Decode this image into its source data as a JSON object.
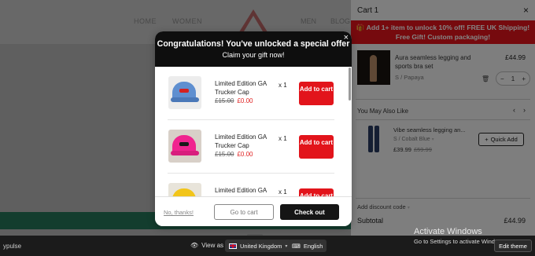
{
  "store_nav": {
    "left_items": [
      "HOME",
      "WOMEN"
    ],
    "right_items": [
      "MEN",
      "BLOG"
    ]
  },
  "popup": {
    "title": "Congratulations! You've unlocked a special offer",
    "subtitle": "Claim your gift now!",
    "close_icon": "×",
    "offers": [
      {
        "name": "Limited Edition GA Trucker Cap",
        "old_price": "£15.00",
        "new_price": "£0.00",
        "qty": "x 1",
        "button": "Add to cart",
        "cap_color": "#5f8fd0",
        "image_icon": "trucker-cap-blue"
      },
      {
        "name": "Limited Edition GA Trucker Cap",
        "old_price": "£15.00",
        "new_price": "£0.00",
        "qty": "x 1",
        "button": "Add to cart",
        "cap_color": "#f0248f",
        "image_icon": "trucker-cap-pink"
      },
      {
        "name": "Limited Edition GA Trucker Cap",
        "old_price": "",
        "new_price": "",
        "qty": "x 1",
        "button": "Add to cart",
        "cap_color": "#f2c51a",
        "image_icon": "trucker-cap-yellow"
      }
    ],
    "no_thanks": "No, thanks!",
    "go_to_cart": "Go to cart",
    "checkout": "Check out"
  },
  "cart": {
    "title": "Cart 1",
    "close_icon": "×",
    "promo": "🎁 Add 1+ item to unlock 10% off! FREE UK Shipping! Free Gift! Custom packaging!",
    "item": {
      "name": "Aura seamless legging and sports bra set",
      "variant": "S / Papaya",
      "price": "£44.99",
      "quantity": "1",
      "minus": "−",
      "plus": "+"
    },
    "you_may_also_like": "You May Also Like",
    "recommendation": {
      "name": "Vibe seamless legging an...",
      "variant": "S / Cobalt Blue",
      "price": "£39.99",
      "compare_price": "£59.99",
      "quick_add": "Quick Add"
    },
    "discount_label": "Add discount code",
    "subtotal_label": "Subtotal",
    "subtotal_value": "£44.99"
  },
  "bottom_bar": {
    "brand": "ypulse",
    "view_as": "View as",
    "country": "United Kingdom",
    "language": "English",
    "edit_theme": "Edit theme"
  },
  "watermark": {
    "title": "Activate Windows",
    "subtitle": "Go to Settings to activate Windows."
  },
  "colors": {
    "accent_red": "#e2141b",
    "popup_header": "#0e0e0e",
    "checkout_button": "#151515",
    "sale_price": "#e02020"
  }
}
